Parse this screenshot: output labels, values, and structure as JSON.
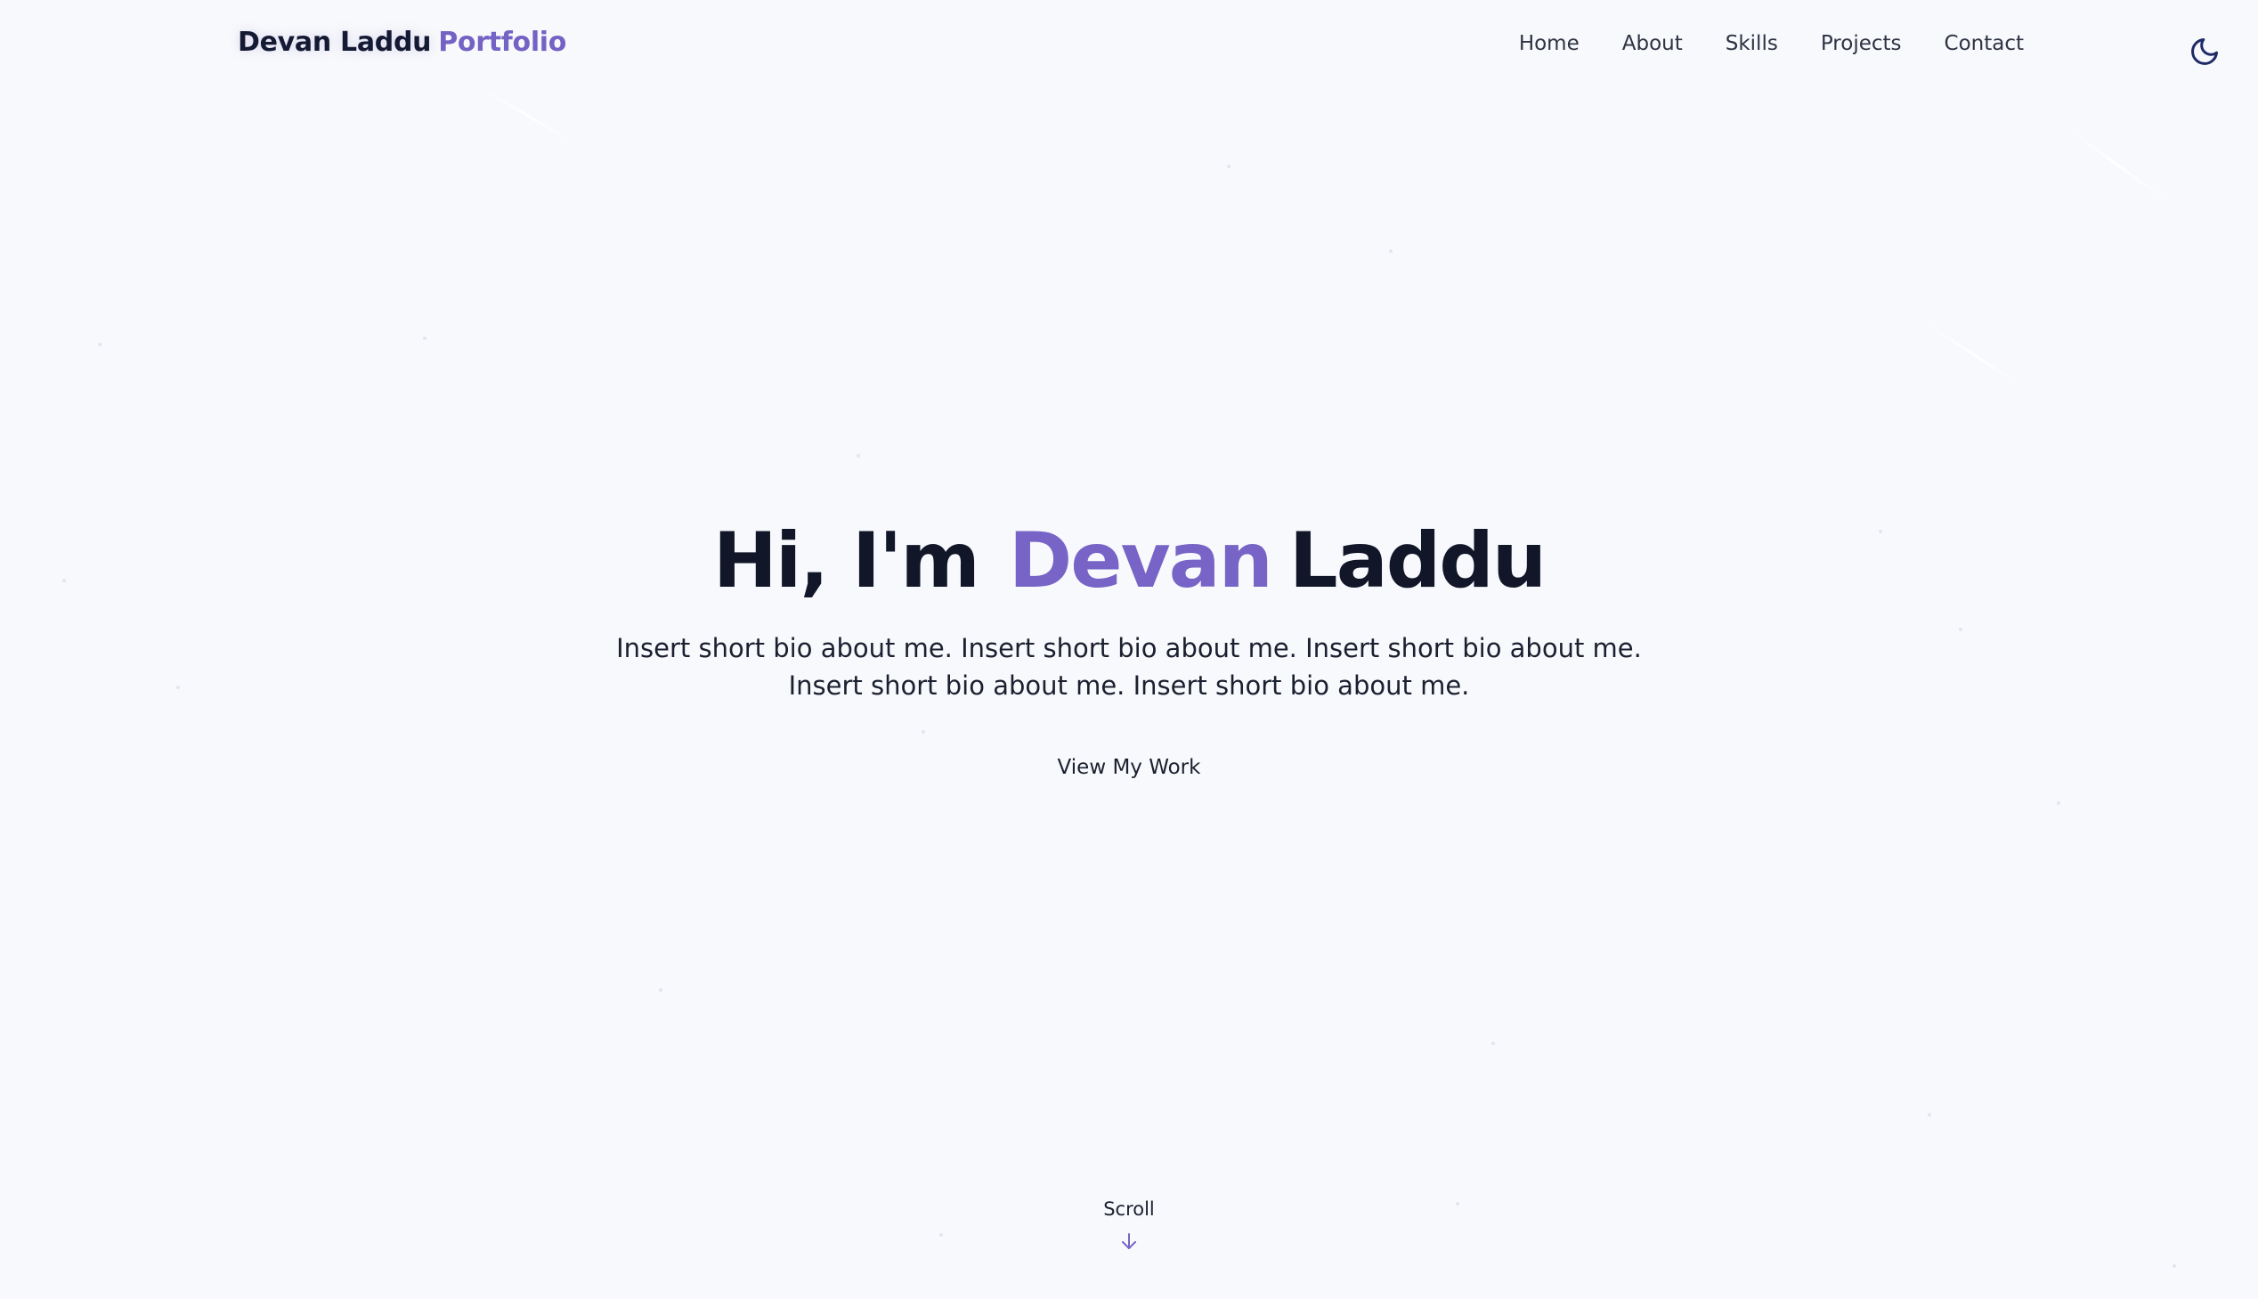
{
  "header": {
    "brand_name": "Devan Laddu",
    "brand_accent": "Portfolio",
    "nav": [
      "Home",
      "About",
      "Skills",
      "Projects",
      "Contact"
    ],
    "theme_toggle_icon": "moon-icon"
  },
  "hero": {
    "greeting": "Hi, I'm",
    "first_name": "Devan",
    "last_name": "Laddu",
    "bio": "Insert short bio about me. Insert short bio about me. Insert short bio about me. Insert short bio about me. Insert short bio about me.",
    "cta_label": "View My Work"
  },
  "scroll": {
    "label": "Scroll",
    "icon": "arrow-down-icon"
  },
  "colors": {
    "background": "#f8f9fc",
    "accent": "#7764c6",
    "text": "#111729"
  }
}
